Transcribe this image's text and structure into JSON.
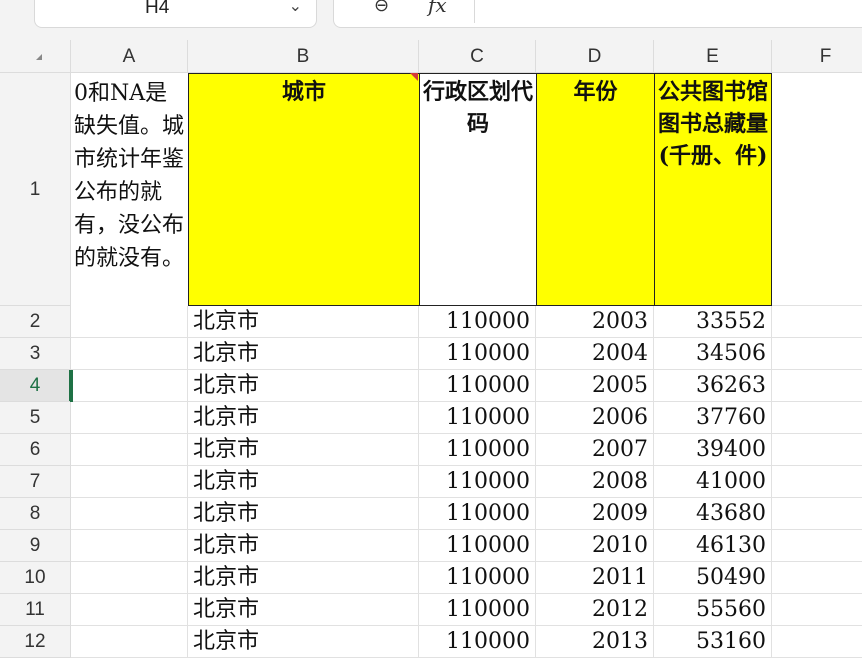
{
  "toolbar": {
    "cell_ref": "H4",
    "fx_label": "fx"
  },
  "columns": [
    "A",
    "B",
    "C",
    "D",
    "E",
    "F"
  ],
  "rows": [
    "1",
    "2",
    "3",
    "4",
    "5",
    "6",
    "7",
    "8",
    "9",
    "10",
    "11",
    "12"
  ],
  "active_row": "4",
  "note_text": "0和NA是缺失值。城市统计年鉴公布的就有，没公布的就没有。",
  "headers": {
    "city": "城市",
    "code": "行政区划代码",
    "year": "年份",
    "books": "公共图书馆图书总藏量(千册、件)"
  },
  "colors": {
    "header_fill": "#ffff00",
    "active_green": "#1e7145"
  },
  "data_rows": [
    {
      "city": "北京市",
      "code": "110000",
      "year": "2003",
      "books": "33552"
    },
    {
      "city": "北京市",
      "code": "110000",
      "year": "2004",
      "books": "34506"
    },
    {
      "city": "北京市",
      "code": "110000",
      "year": "2005",
      "books": "36263"
    },
    {
      "city": "北京市",
      "code": "110000",
      "year": "2006",
      "books": "37760"
    },
    {
      "city": "北京市",
      "code": "110000",
      "year": "2007",
      "books": "39400"
    },
    {
      "city": "北京市",
      "code": "110000",
      "year": "2008",
      "books": "41000"
    },
    {
      "city": "北京市",
      "code": "110000",
      "year": "2009",
      "books": "43680"
    },
    {
      "city": "北京市",
      "code": "110000",
      "year": "2010",
      "books": "46130"
    },
    {
      "city": "北京市",
      "code": "110000",
      "year": "2011",
      "books": "50490"
    },
    {
      "city": "北京市",
      "code": "110000",
      "year": "2012",
      "books": "55560"
    },
    {
      "city": "北京市",
      "code": "110000",
      "year": "2013",
      "books": "53160"
    }
  ]
}
